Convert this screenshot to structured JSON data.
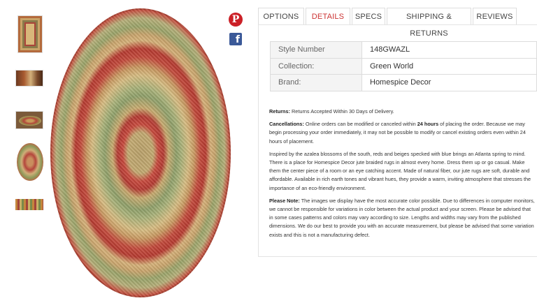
{
  "social": {
    "pinterest_glyph": "P",
    "facebook_glyph": "f"
  },
  "tabs": [
    {
      "label": "OPTIONS",
      "active": false
    },
    {
      "label": "DETAILS",
      "active": true
    },
    {
      "label": "SPECS",
      "active": false
    },
    {
      "label": "SHIPPING & RETURNS",
      "active": false
    },
    {
      "label": "REVIEWS",
      "active": false
    }
  ],
  "details": {
    "rows": [
      {
        "key": "Style Number",
        "value": "148GWAZL"
      },
      {
        "key": "Collection:",
        "value": "Green World"
      },
      {
        "key": "Brand:",
        "value": "Homespice Decor"
      }
    ],
    "returns": {
      "label": "Returns:",
      "text": " Returns Accepted Within 30 Days of Delivery."
    },
    "cancellations": {
      "label": "Cancellations:",
      "text_before": " Online orders can be modified or canceled within ",
      "bold": "24 hours",
      "text_after": " of placing the order. Because we may begin processing your order immediately, it may not be possible to modify or cancel existing orders even within 24 hours of placement."
    },
    "description": "Inspired by the azalea blossoms of the south, reds and beiges specked with blue brings an Atlanta spring to mind. There is a place for Homespice Decor jute braided rugs in almost every home. Dress them up or go casual. Make them the center piece of a room or an eye catching accent. Made of natural fiber, our jute rugs are soft, durable and affordable. Available in rich earth tones and vibrant hues, they provide a warm, inviting atmosphere that stresses the importance of an eco-friendly environment.",
    "note": {
      "label": "Please Note:",
      "text": " The images we display have the most accurate color possible. Due to differences in computer monitors, we cannot be responsible for variations in color between the actual product and your screen. Please be advised that in some cases patterns and colors may vary according to size. Lengths and widths may vary from the published dimensions. We do our best to provide you with an accurate measurement, but please be advised that some variation exists and this is not a manufacturing defect."
    }
  },
  "colors": {
    "active_tab": "#cc3333",
    "pinterest": "#cb2027",
    "facebook": "#3b5998"
  }
}
